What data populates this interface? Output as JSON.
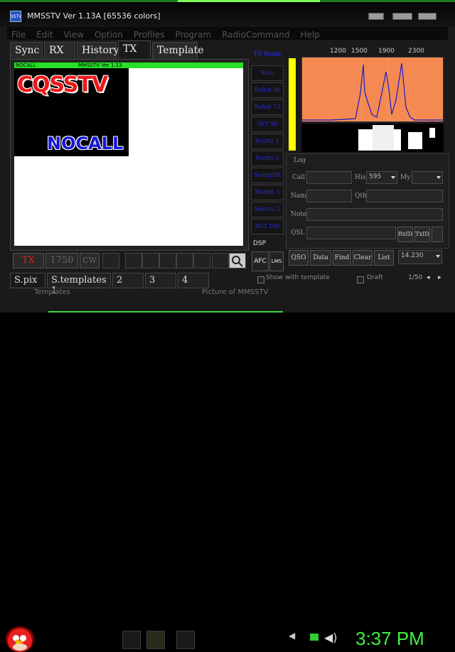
{
  "window": {
    "title": "MMSSTV Ver 1.13A [65536 colors]"
  },
  "menu": [
    "File",
    "Edit",
    "View",
    "Option",
    "Profiles",
    "Program",
    "RadioCommand",
    "Help"
  ],
  "tabs": [
    "Sync",
    "RX",
    "History",
    "TX",
    "Template"
  ],
  "preview": {
    "bar_left": "NOCALL",
    "bar_mid": "MMSSTV Ver 1.13",
    "cq_text": "CQSSTV",
    "callsign_text": "NOCALL"
  },
  "modes": {
    "header": "TX Mode",
    "items": [
      "Auto",
      "Robot 36",
      "Robot 72",
      "AVT 90",
      "Scotty 1",
      "Scotty 2",
      "ScottyDX",
      "Martin 1",
      "Martin 2",
      "SC2 180"
    ]
  },
  "spectrum": {
    "labels": [
      "1200",
      "1500",
      "1900",
      "2300"
    ],
    "bar_color": "#ffff00",
    "bg_color": "#f48a52",
    "trace_color": "#1a1ad0"
  },
  "log": {
    "title": "Log",
    "call_label": "Call",
    "his_label": "His",
    "his_value": "595",
    "my_label": "My",
    "name_label": "Name",
    "qth_label": "Qth",
    "note_label": "Note",
    "qsl_label": "QSL",
    "rxid_label": "RxID",
    "txid_label": "TxID",
    "btn_qso": "QSO",
    "btn_data": "Data",
    "btn_find": "Find",
    "btn_clear": "Clear",
    "btn_list": "List",
    "freq_value": "14.230"
  },
  "dsp": {
    "label": "DSP",
    "afc": "AFC",
    "lms": "LMS"
  },
  "toolbar": {
    "tx": "TX",
    "tone": "1750",
    "cw": "CW"
  },
  "bottom_tabs": [
    "S.pix",
    "S.templates 1",
    "2",
    "3",
    "4"
  ],
  "show_template": "Show with template",
  "draft_label": "Draft",
  "page_counter": "1/50",
  "background_labels": [
    "Templates",
    "Picture of MMSSTV"
  ],
  "clock": "3:37 PM",
  "colors": {
    "accent": "#42d442",
    "mode_text": "#2a2af0",
    "clock": "#40f040"
  }
}
